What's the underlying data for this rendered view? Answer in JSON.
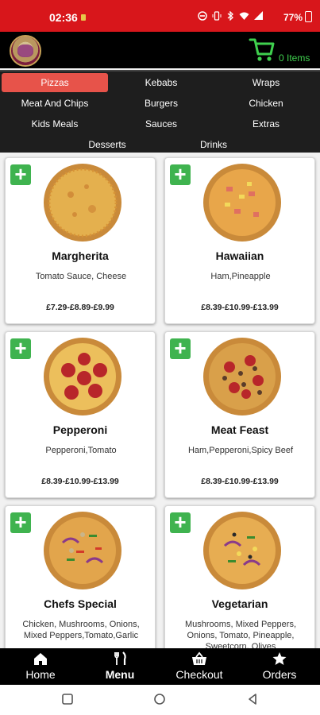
{
  "status": {
    "time": "02:36",
    "battery": "77%"
  },
  "header": {
    "cart_count": "0 Items"
  },
  "categories": [
    {
      "label": "Pizzas",
      "active": true
    },
    {
      "label": "Kebabs"
    },
    {
      "label": "Wraps"
    },
    {
      "label": "Meat And Chips"
    },
    {
      "label": "Burgers"
    },
    {
      "label": "Chicken"
    },
    {
      "label": "Kids Meals"
    },
    {
      "label": "Sauces"
    },
    {
      "label": "Extras"
    },
    {
      "label": "Desserts"
    },
    {
      "label": "Drinks"
    }
  ],
  "products": [
    {
      "name": "Margherita",
      "desc": "Tomato Sauce, Cheese",
      "price": "£7.29-£8.89-£9.99"
    },
    {
      "name": "Hawaiian",
      "desc": "Ham,Pineapple",
      "price": "£8.39-£10.99-£13.99"
    },
    {
      "name": "Pepperoni",
      "desc": "Pepperoni,Tomato",
      "price": "£8.39-£10.99-£13.99"
    },
    {
      "name": "Meat Feast",
      "desc": "Ham,Pepperoni,Spicy Beef",
      "price": "£8.39-£10.99-£13.99"
    },
    {
      "name": "Chefs Special",
      "desc": "Chicken, Mushrooms, Onions, Mixed Peppers,Tomato,Garlic",
      "price": ""
    },
    {
      "name": "Vegetarian",
      "desc": "Mushrooms, Mixed Peppers, Onions, Tomato, Pineapple, Sweetcorn, Olives",
      "price": ""
    }
  ],
  "nav": [
    {
      "label": "Home",
      "icon": "home-icon"
    },
    {
      "label": "Menu",
      "icon": "cutlery-icon"
    },
    {
      "label": "Checkout",
      "icon": "basket-icon"
    },
    {
      "label": "Orders",
      "icon": "star-icon"
    }
  ],
  "colors": {
    "status_bar": "#d8161b",
    "accent_green": "#3fb34f",
    "active_tab": "#e7534a"
  }
}
